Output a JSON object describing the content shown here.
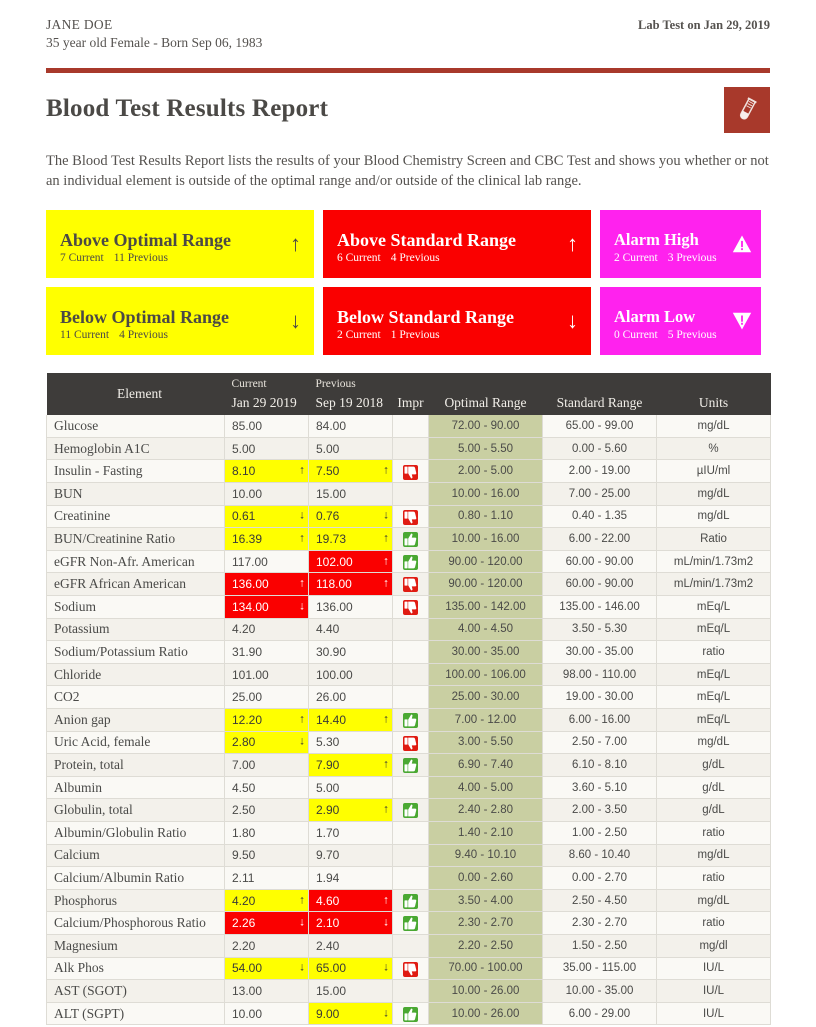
{
  "patient": {
    "name": "JANE DOE",
    "details": "35 year old Female - Born Sep 06, 1983",
    "lab_date": "Lab Test on Jan 29, 2019"
  },
  "header": {
    "title": "Blood Test Results Report",
    "intro": "The Blood Test Results Report lists the results of your Blood Chemistry Screen and CBC Test and shows you whether or not an individual element is outside of the optimal range and/or outside of the clinical lab range.",
    "tube_icon": "test-tube-icon"
  },
  "colors": {
    "accent_red": "#a8392b",
    "flag_yellow": "#ffff00",
    "flag_red": "#fa0000",
    "flag_magenta": "#ff22ee",
    "header_dark": "#3e3c3a",
    "optimal_green": "#c9cfa2"
  },
  "summary": [
    {
      "title": "Above Optimal Range",
      "current": "7 Current",
      "previous": "11 Previous",
      "icon": "arrow-up-icon",
      "glyph": "↑",
      "style": "yellow"
    },
    {
      "title": "Above Standard Range",
      "current": "6 Current",
      "previous": "4 Previous",
      "icon": "arrow-up-icon",
      "glyph": "↑",
      "style": "red"
    },
    {
      "title": "Alarm High",
      "current": "2 Current",
      "previous": "3 Previous",
      "icon": "warning-triangle-up-icon",
      "glyph": "⚠",
      "style": "magenta"
    },
    {
      "title": "Below Optimal Range",
      "current": "11 Current",
      "previous": "4 Previous",
      "icon": "arrow-down-icon",
      "glyph": "↓",
      "style": "yellow"
    },
    {
      "title": "Below Standard Range",
      "current": "2 Current",
      "previous": "1 Previous",
      "icon": "arrow-down-icon",
      "glyph": "↓",
      "style": "red"
    },
    {
      "title": "Alarm Low",
      "current": "0 Current",
      "previous": "5 Previous",
      "icon": "warning-triangle-down-icon",
      "glyph": "⚠",
      "style": "magenta"
    }
  ],
  "table": {
    "columns": {
      "element": "Element",
      "current_small": "Current",
      "current_date": "Jan 29 2019",
      "previous_small": "Previous",
      "previous_date": "Sep 19 2018",
      "impr": "Impr",
      "optimal": "Optimal Range",
      "standard": "Standard Range",
      "units": "Units"
    },
    "rows": [
      {
        "element": "Glucose",
        "current": "85.00",
        "current_flag": "none",
        "current_arrow": "",
        "previous": "84.00",
        "previous_flag": "none",
        "previous_arrow": "",
        "impr": "none",
        "optimal": "72.00 - 90.00",
        "standard": "65.00 - 99.00",
        "units": "mg/dL"
      },
      {
        "element": "Hemoglobin A1C",
        "current": "5.00",
        "current_flag": "none",
        "current_arrow": "",
        "previous": "5.00",
        "previous_flag": "none",
        "previous_arrow": "",
        "impr": "none",
        "optimal": "5.00 - 5.50",
        "standard": "0.00 - 5.60",
        "units": "%"
      },
      {
        "element": "Insulin - Fasting",
        "current": "8.10",
        "current_flag": "yellow",
        "current_arrow": "↑",
        "previous": "7.50",
        "previous_flag": "yellow",
        "previous_arrow": "↑",
        "impr": "down",
        "optimal": "2.00 - 5.00",
        "standard": "2.00 - 19.00",
        "units": "µIU/ml"
      },
      {
        "element": "BUN",
        "current": "10.00",
        "current_flag": "none",
        "current_arrow": "",
        "previous": "15.00",
        "previous_flag": "none",
        "previous_arrow": "",
        "impr": "none",
        "optimal": "10.00 - 16.00",
        "standard": "7.00 - 25.00",
        "units": "mg/dL"
      },
      {
        "element": "Creatinine",
        "current": "0.61",
        "current_flag": "yellow",
        "current_arrow": "↓",
        "previous": "0.76",
        "previous_flag": "yellow",
        "previous_arrow": "↓",
        "impr": "down",
        "optimal": "0.80 - 1.10",
        "standard": "0.40 - 1.35",
        "units": "mg/dL"
      },
      {
        "element": "BUN/Creatinine Ratio",
        "current": "16.39",
        "current_flag": "yellow",
        "current_arrow": "↑",
        "previous": "19.73",
        "previous_flag": "yellow",
        "previous_arrow": "↑",
        "impr": "up",
        "optimal": "10.00 - 16.00",
        "standard": "6.00 - 22.00",
        "units": "Ratio"
      },
      {
        "element": "eGFR Non-Afr. American",
        "current": "117.00",
        "current_flag": "none",
        "current_arrow": "",
        "previous": "102.00",
        "previous_flag": "red",
        "previous_arrow": "↑",
        "impr": "up",
        "optimal": "90.00 - 120.00",
        "standard": "60.00 - 90.00",
        "units": "mL/min/1.73m2"
      },
      {
        "element": "eGFR African American",
        "current": "136.00",
        "current_flag": "red",
        "current_arrow": "↑",
        "previous": "118.00",
        "previous_flag": "red",
        "previous_arrow": "↑",
        "impr": "down",
        "optimal": "90.00 - 120.00",
        "standard": "60.00 - 90.00",
        "units": "mL/min/1.73m2"
      },
      {
        "element": "Sodium",
        "current": "134.00",
        "current_flag": "red",
        "current_arrow": "↓",
        "previous": "136.00",
        "previous_flag": "none",
        "previous_arrow": "",
        "impr": "down",
        "optimal": "135.00 - 142.00",
        "standard": "135.00 - 146.00",
        "units": "mEq/L"
      },
      {
        "element": "Potassium",
        "current": "4.20",
        "current_flag": "none",
        "current_arrow": "",
        "previous": "4.40",
        "previous_flag": "none",
        "previous_arrow": "",
        "impr": "none",
        "optimal": "4.00 - 4.50",
        "standard": "3.50 - 5.30",
        "units": "mEq/L"
      },
      {
        "element": "Sodium/Potassium Ratio",
        "current": "31.90",
        "current_flag": "none",
        "current_arrow": "",
        "previous": "30.90",
        "previous_flag": "none",
        "previous_arrow": "",
        "impr": "none",
        "optimal": "30.00 - 35.00",
        "standard": "30.00 - 35.00",
        "units": "ratio"
      },
      {
        "element": "Chloride",
        "current": "101.00",
        "current_flag": "none",
        "current_arrow": "",
        "previous": "100.00",
        "previous_flag": "none",
        "previous_arrow": "",
        "impr": "none",
        "optimal": "100.00 - 106.00",
        "standard": "98.00 - 110.00",
        "units": "mEq/L"
      },
      {
        "element": "CO2",
        "current": "25.00",
        "current_flag": "none",
        "current_arrow": "",
        "previous": "26.00",
        "previous_flag": "none",
        "previous_arrow": "",
        "impr": "none",
        "optimal": "25.00 - 30.00",
        "standard": "19.00 - 30.00",
        "units": "mEq/L"
      },
      {
        "element": "Anion gap",
        "current": "12.20",
        "current_flag": "yellow",
        "current_arrow": "↑",
        "previous": "14.40",
        "previous_flag": "yellow",
        "previous_arrow": "↑",
        "impr": "up",
        "optimal": "7.00 - 12.00",
        "standard": "6.00 - 16.00",
        "units": "mEq/L"
      },
      {
        "element": "Uric Acid, female",
        "current": "2.80",
        "current_flag": "yellow",
        "current_arrow": "↓",
        "previous": "5.30",
        "previous_flag": "none",
        "previous_arrow": "",
        "impr": "down",
        "optimal": "3.00 - 5.50",
        "standard": "2.50 - 7.00",
        "units": "mg/dL"
      },
      {
        "element": "Protein, total",
        "current": "7.00",
        "current_flag": "none",
        "current_arrow": "",
        "previous": "7.90",
        "previous_flag": "yellow",
        "previous_arrow": "↑",
        "impr": "up",
        "optimal": "6.90 - 7.40",
        "standard": "6.10 - 8.10",
        "units": "g/dL"
      },
      {
        "element": "Albumin",
        "current": "4.50",
        "current_flag": "none",
        "current_arrow": "",
        "previous": "5.00",
        "previous_flag": "none",
        "previous_arrow": "",
        "impr": "none",
        "optimal": "4.00 - 5.00",
        "standard": "3.60 - 5.10",
        "units": "g/dL"
      },
      {
        "element": "Globulin, total",
        "current": "2.50",
        "current_flag": "none",
        "current_arrow": "",
        "previous": "2.90",
        "previous_flag": "yellow",
        "previous_arrow": "↑",
        "impr": "up",
        "optimal": "2.40 - 2.80",
        "standard": "2.00 - 3.50",
        "units": "g/dL"
      },
      {
        "element": "Albumin/Globulin Ratio",
        "current": "1.80",
        "current_flag": "none",
        "current_arrow": "",
        "previous": "1.70",
        "previous_flag": "none",
        "previous_arrow": "",
        "impr": "none",
        "optimal": "1.40 - 2.10",
        "standard": "1.00 - 2.50",
        "units": "ratio"
      },
      {
        "element": "Calcium",
        "current": "9.50",
        "current_flag": "none",
        "current_arrow": "",
        "previous": "9.70",
        "previous_flag": "none",
        "previous_arrow": "",
        "impr": "none",
        "optimal": "9.40 - 10.10",
        "standard": "8.60 - 10.40",
        "units": "mg/dL"
      },
      {
        "element": "Calcium/Albumin Ratio",
        "current": "2.11",
        "current_flag": "none",
        "current_arrow": "",
        "previous": "1.94",
        "previous_flag": "none",
        "previous_arrow": "",
        "impr": "none",
        "optimal": "0.00 - 2.60",
        "standard": "0.00 - 2.70",
        "units": "ratio"
      },
      {
        "element": "Phosphorus",
        "current": "4.20",
        "current_flag": "yellow",
        "current_arrow": "↑",
        "previous": "4.60",
        "previous_flag": "red",
        "previous_arrow": "↑",
        "impr": "up",
        "optimal": "3.50 - 4.00",
        "standard": "2.50 - 4.50",
        "units": "mg/dL"
      },
      {
        "element": "Calcium/Phosphorous Ratio",
        "current": "2.26",
        "current_flag": "red",
        "current_arrow": "↓",
        "previous": "2.10",
        "previous_flag": "red",
        "previous_arrow": "↓",
        "impr": "up",
        "optimal": "2.30 - 2.70",
        "standard": "2.30 - 2.70",
        "units": "ratio"
      },
      {
        "element": "Magnesium",
        "current": "2.20",
        "current_flag": "none",
        "current_arrow": "",
        "previous": "2.40",
        "previous_flag": "none",
        "previous_arrow": "",
        "impr": "none",
        "optimal": "2.20 - 2.50",
        "standard": "1.50 - 2.50",
        "units": "mg/dl"
      },
      {
        "element": "Alk Phos",
        "current": "54.00",
        "current_flag": "yellow",
        "current_arrow": "↓",
        "previous": "65.00",
        "previous_flag": "yellow",
        "previous_arrow": "↓",
        "impr": "down",
        "optimal": "70.00 - 100.00",
        "standard": "35.00 - 115.00",
        "units": "IU/L"
      },
      {
        "element": "AST (SGOT)",
        "current": "13.00",
        "current_flag": "none",
        "current_arrow": "",
        "previous": "15.00",
        "previous_flag": "none",
        "previous_arrow": "",
        "impr": "none",
        "optimal": "10.00 - 26.00",
        "standard": "10.00 - 35.00",
        "units": "IU/L"
      },
      {
        "element": "ALT (SGPT)",
        "current": "10.00",
        "current_flag": "none",
        "current_arrow": "",
        "previous": "9.00",
        "previous_flag": "yellow",
        "previous_arrow": "↓",
        "impr": "up",
        "optimal": "10.00 - 26.00",
        "standard": "6.00 - 29.00",
        "units": "IU/L"
      }
    ]
  }
}
